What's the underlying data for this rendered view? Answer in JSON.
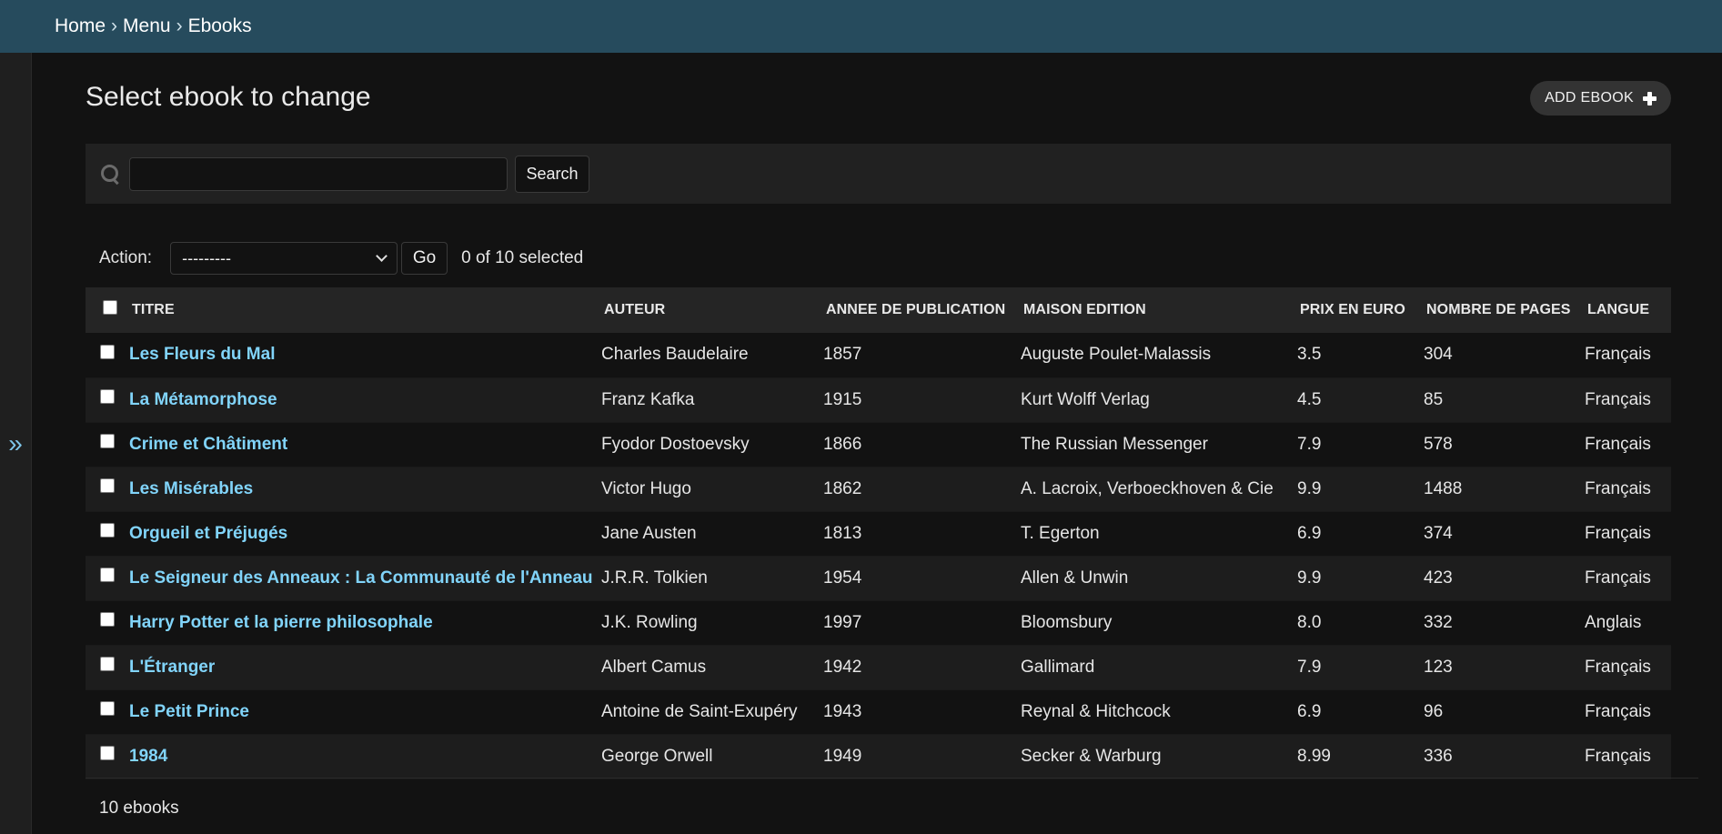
{
  "breadcrumb": {
    "items": [
      "Home",
      "Menu",
      "Ebooks"
    ],
    "separator": "›"
  },
  "sidebar_toggle": {
    "label": "»"
  },
  "page": {
    "title": "Select ebook to change",
    "add_label": "ADD EBOOK"
  },
  "search": {
    "value": "",
    "placeholder": "",
    "button_label": "Search"
  },
  "actions": {
    "label": "Action:",
    "selected_option": "---------",
    "go_label": "Go",
    "selected_count": "0 of 10 selected"
  },
  "table": {
    "columns": [
      "TITRE",
      "AUTEUR",
      "ANNEE DE PUBLICATION",
      "MAISON EDITION",
      "PRIX EN EURO",
      "NOMBRE DE PAGES",
      "LANGUE"
    ],
    "rows": [
      [
        "Les Fleurs du Mal",
        "Charles Baudelaire",
        "1857",
        "Auguste Poulet-Malassis",
        "3.5",
        "304",
        "Français"
      ],
      [
        "La Métamorphose",
        "Franz Kafka",
        "1915",
        "Kurt Wolff Verlag",
        "4.5",
        "85",
        "Français"
      ],
      [
        "Crime et Châtiment",
        "Fyodor Dostoevsky",
        "1866",
        "The Russian Messenger",
        "7.9",
        "578",
        "Français"
      ],
      [
        "Les Misérables",
        "Victor Hugo",
        "1862",
        "A. Lacroix, Verboeckhoven & Cie",
        "9.9",
        "1488",
        "Français"
      ],
      [
        "Orgueil et Préjugés",
        "Jane Austen",
        "1813",
        "T. Egerton",
        "6.9",
        "374",
        "Français"
      ],
      [
        "Le Seigneur des Anneaux : La Communauté de l'Anneau",
        "J.R.R. Tolkien",
        "1954",
        "Allen & Unwin",
        "9.9",
        "423",
        "Français"
      ],
      [
        "Harry Potter et la pierre philosophale",
        "J.K. Rowling",
        "1997",
        "Bloomsbury",
        "8.0",
        "332",
        "Anglais"
      ],
      [
        "L'Étranger",
        "Albert Camus",
        "1942",
        "Gallimard",
        "7.9",
        "123",
        "Français"
      ],
      [
        "Le Petit Prince",
        "Antoine de Saint-Exupéry",
        "1943",
        "Reynal & Hitchcock",
        "6.9",
        "96",
        "Français"
      ],
      [
        "1984",
        "George Orwell",
        "1949",
        "Secker & Warburg",
        "8.99",
        "336",
        "Français"
      ]
    ]
  },
  "footer": {
    "count": "10 ebooks"
  },
  "colors": {
    "header_bg": "#264b5d",
    "link": "#81d4fa",
    "page_bg": "#121212"
  }
}
